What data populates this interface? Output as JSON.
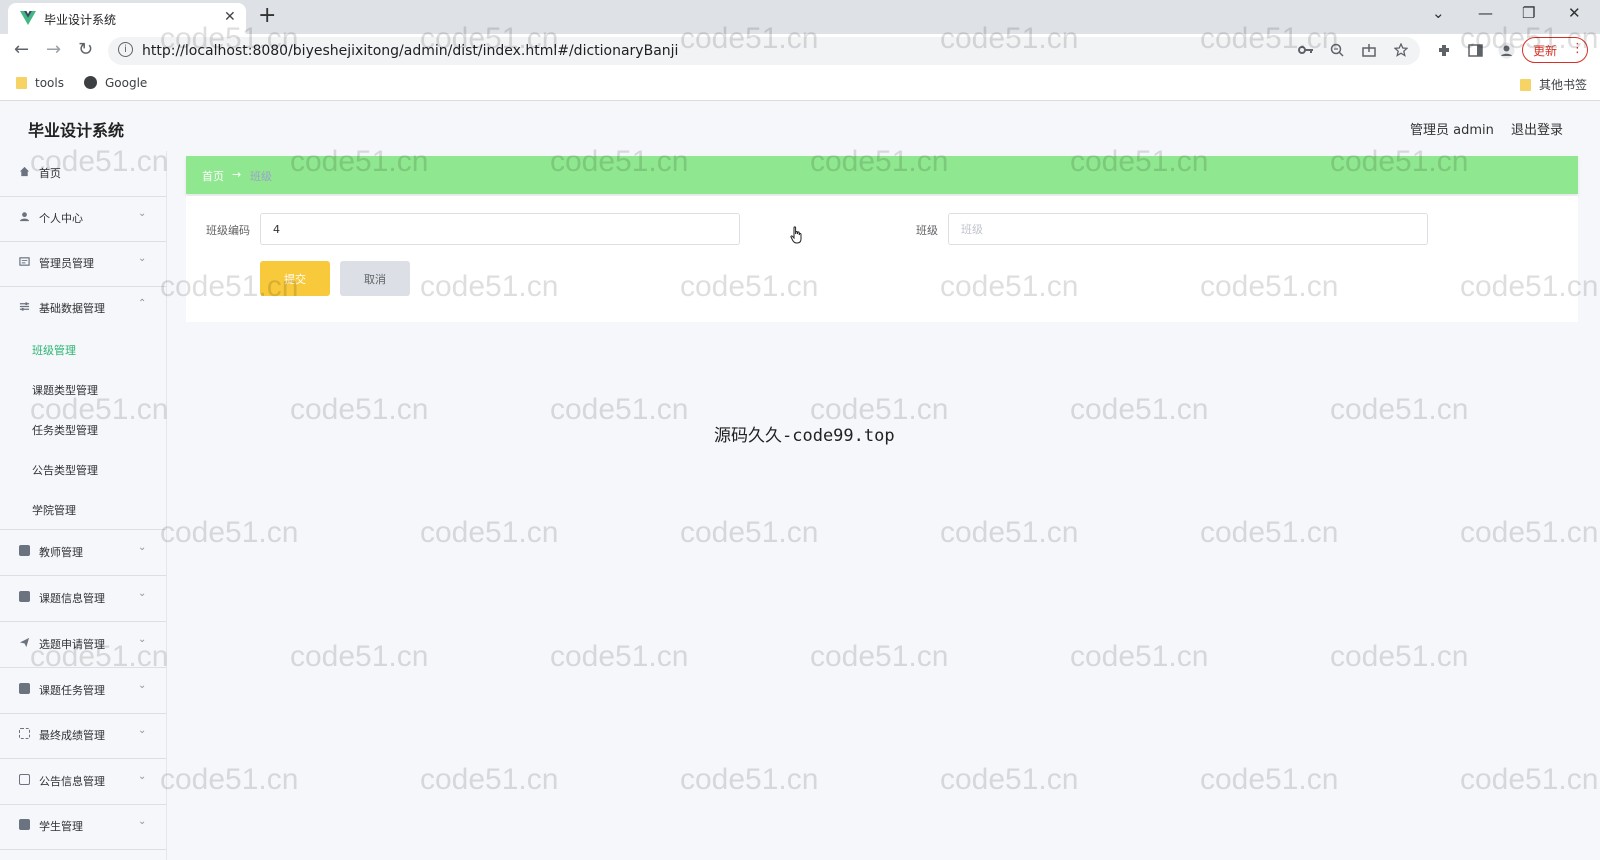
{
  "browser": {
    "tab_title": "毕业设计系统",
    "tab_close": "✕",
    "new_tab": "+",
    "window_controls": [
      "⌄",
      "—",
      "❐",
      "✕"
    ],
    "nav": {
      "back": "←",
      "forward": "→",
      "reload": "↻"
    },
    "url": "http://localhost:8080/biyeshejixitong/admin/dist/index.html#/dictionaryBanji",
    "omnibox_icons": [
      "key-icon",
      "zoom-icon",
      "share-icon",
      "star-icon"
    ],
    "toolbar_icons": [
      "extensions-icon",
      "sidepanel-icon",
      "profile-icon"
    ],
    "update_label": "更新",
    "update_menu": "⋮",
    "bookmarks": [
      {
        "label": "tools",
        "icon": "folder-icon"
      },
      {
        "label": "Google",
        "icon": "globe-icon"
      }
    ],
    "other_bookmarks": "其他书签"
  },
  "app": {
    "title": "毕业设计系统",
    "user": "管理员 admin",
    "logout": "退出登录"
  },
  "sidebar": {
    "items": [
      {
        "label": "首页",
        "icon": "home-icon",
        "caret": ""
      },
      {
        "label": "个人中心",
        "icon": "user-icon",
        "caret": "⌄"
      },
      {
        "label": "管理员管理",
        "icon": "admin-icon",
        "caret": "⌄"
      },
      {
        "label": "基础数据管理",
        "icon": "sliders-icon",
        "caret": "⌃"
      }
    ],
    "sub_items": [
      {
        "label": "班级管理",
        "active": true
      },
      {
        "label": "课题类型管理"
      },
      {
        "label": "任务类型管理"
      },
      {
        "label": "公告类型管理"
      },
      {
        "label": "学院管理"
      }
    ],
    "items_after": [
      {
        "label": "教师管理",
        "icon": "teacher-icon",
        "caret": "⌄"
      },
      {
        "label": "课题信息管理",
        "icon": "topic-icon",
        "caret": "⌄"
      },
      {
        "label": "选题申请管理",
        "icon": "send-icon",
        "caret": "⌄"
      },
      {
        "label": "课题任务管理",
        "icon": "task-icon",
        "caret": "⌄"
      },
      {
        "label": "最终成绩管理",
        "icon": "score-icon",
        "caret": "⌄"
      },
      {
        "label": "公告信息管理",
        "icon": "notice-icon",
        "caret": "⌄"
      },
      {
        "label": "学生管理",
        "icon": "student-icon",
        "caret": "⌄"
      }
    ]
  },
  "breadcrumb": {
    "home": "首页",
    "separator": "→",
    "current": "班级"
  },
  "form": {
    "code_label": "班级编码",
    "code_value": "4",
    "name_label": "班级",
    "name_placeholder": "班级",
    "submit": "提交",
    "cancel": "取消"
  },
  "overlay_text": "源码久久-code99.top",
  "watermark": "code51.cn",
  "colors": {
    "breadcrumb_bg": "#8fe78f",
    "submit_bg": "#f8c93a",
    "active_menu": "#2bb673",
    "update_red": "#d93025"
  }
}
